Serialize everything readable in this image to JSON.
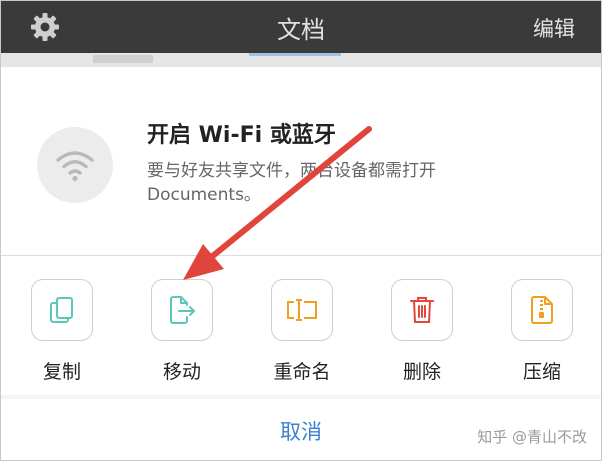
{
  "header": {
    "title": "文档",
    "edit_label": "编辑",
    "settings_icon": "gear-icon"
  },
  "prompt": {
    "icon": "wifi-icon",
    "title": "开启 Wi-Fi 或蓝牙",
    "description": "要与好友共享文件，两台设备都需打开 Documents。"
  },
  "actions": [
    {
      "label": "复制",
      "icon": "copy-icon",
      "color": "#5cc6b8"
    },
    {
      "label": "移动",
      "icon": "move-icon",
      "color": "#5cc6b8"
    },
    {
      "label": "重命名",
      "icon": "rename-icon",
      "color": "#f0a020"
    },
    {
      "label": "删除",
      "icon": "trash-icon",
      "color": "#e2483a"
    },
    {
      "label": "压缩",
      "icon": "zip-icon",
      "color": "#f0a020"
    }
  ],
  "footer": {
    "cancel_label": "取消"
  },
  "watermark": "知乎 @青山不改",
  "colors": {
    "header_bg": "#3a3a3a",
    "cancel_text": "#3d7fd0",
    "annotation_arrow": "#e0443a"
  }
}
